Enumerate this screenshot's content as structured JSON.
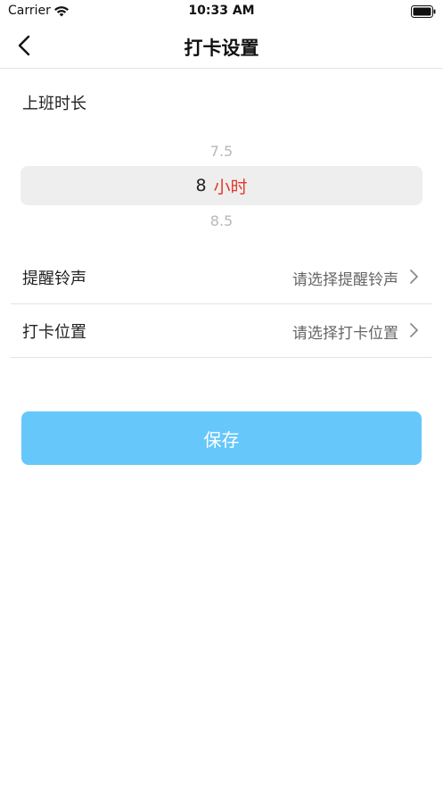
{
  "status_bar": {
    "carrier": "Carrier",
    "time": "10:33 AM"
  },
  "nav": {
    "title": "打卡设置",
    "back_icon": "chevron-left-icon"
  },
  "work_duration": {
    "label": "上班时长",
    "picker": {
      "prev": "7.5",
      "selected": "8",
      "unit": "小时",
      "next": "8.5"
    }
  },
  "settings": [
    {
      "label": "提醒铃声",
      "value": "请选择提醒铃声"
    },
    {
      "label": "打卡位置",
      "value": "请选择打卡位置"
    }
  ],
  "save_button": {
    "label": "保存"
  },
  "colors": {
    "accent": "#66c7fa",
    "unit_red": "#e0392b",
    "picker_bg": "#eeeeee",
    "divider": "#e3e3e3"
  }
}
